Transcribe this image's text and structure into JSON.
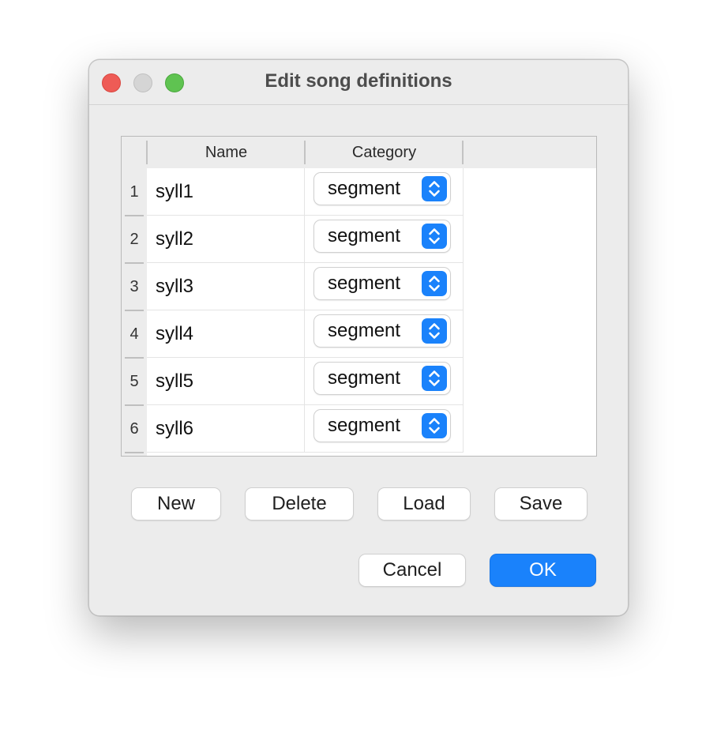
{
  "window": {
    "title": "Edit song definitions"
  },
  "table": {
    "columns": [
      "Name",
      "Category"
    ],
    "rows": [
      {
        "index": "1",
        "name": "syll1",
        "category": "segment"
      },
      {
        "index": "2",
        "name": "syll2",
        "category": "segment"
      },
      {
        "index": "3",
        "name": "syll3",
        "category": "segment"
      },
      {
        "index": "4",
        "name": "syll4",
        "category": "segment"
      },
      {
        "index": "5",
        "name": "syll5",
        "category": "segment"
      },
      {
        "index": "6",
        "name": "syll6",
        "category": "segment"
      }
    ]
  },
  "actions": {
    "new_label": "New",
    "delete_label": "Delete",
    "load_label": "Load",
    "save_label": "Save"
  },
  "footer": {
    "cancel_label": "Cancel",
    "ok_label": "OK"
  },
  "colors": {
    "accent": "#1a82fb",
    "close": "#ee5b56",
    "minimize": "#d5d5d5",
    "zoom": "#5fc351"
  },
  "icons": [
    "close-icon",
    "minimize-icon",
    "zoom-icon",
    "up-down-chevron-icon"
  ]
}
